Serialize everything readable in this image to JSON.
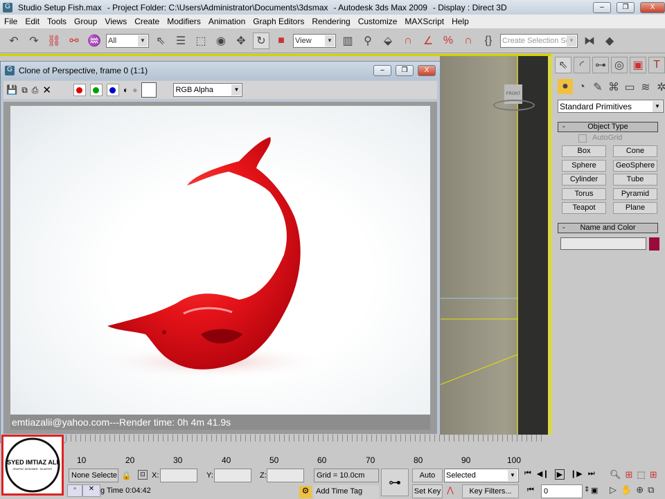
{
  "window": {
    "title": "Studio Setup Fish.max",
    "project": "- Project Folder: C:\\Users\\Administrator\\Documents\\3dsmax",
    "app": "- Autodesk 3ds Max  2009",
    "display": "- Display : Direct 3D",
    "minimize": "–",
    "restore": "❐",
    "close": "X"
  },
  "menu": [
    "File",
    "Edit",
    "Tools",
    "Group",
    "Views",
    "Create",
    "Modifiers",
    "Animation",
    "Graph Editors",
    "Rendering",
    "Customize",
    "MAXScript",
    "Help"
  ],
  "toolbar": {
    "selection_filter": "All",
    "ref_coord": "View",
    "named_selection_placeholder": "Create Selection Set"
  },
  "render_window": {
    "title": "Clone of Perspective, frame 0 (1:1)",
    "channel": "RGB Alpha",
    "caption": "emtiazalii@yahoo.com---Render time: 0h 4m 41.9s",
    "colors": {
      "red": "#e00000",
      "green": "#00a000",
      "blue": "#0000d0"
    }
  },
  "viewport": {
    "label": "FRONT"
  },
  "command_panel": {
    "category": "Standard Primitives",
    "object_type": "Object Type",
    "autogrid": "AutoGrid",
    "buttons": [
      "Box",
      "Cone",
      "Sphere",
      "GeoSphere",
      "Cylinder",
      "Tube",
      "Torus",
      "Pyramid",
      "Teapot",
      "Plane"
    ],
    "name_and_color": "Name and Color",
    "object_color": "#9a0b3a",
    "collapse": "-"
  },
  "timeline": {
    "ticks": [
      "10",
      "20",
      "30",
      "40",
      "50",
      "60",
      "70",
      "80",
      "90",
      "100"
    ]
  },
  "status": {
    "selection": "None Selecte",
    "x_label": "X:",
    "y_label": "Y:",
    "z_label": "Z:",
    "grid": "Grid = 10.0cm",
    "time": "g Time  0:04:42",
    "add_time_tag": "Add Time Tag",
    "auto_key": "Auto Key",
    "set_key": "Set Key",
    "key_mode": "Selected",
    "key_filters": "Key Filters...",
    "frame": "0"
  },
  "logo": {
    "name": "SYED IMTIAZ ALI",
    "subtitle": "GRAPHIC DESIGNER : 3D ARTIST"
  },
  "accent": "#e6e000"
}
